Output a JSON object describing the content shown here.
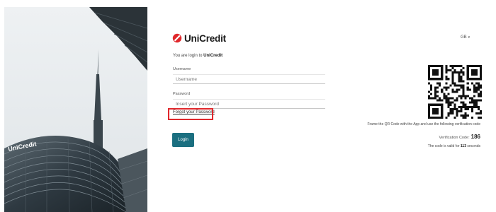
{
  "brand": {
    "name": "UniCredit",
    "building_sign": "UniCredit",
    "accent_color": "#e0282c",
    "primary_color": "#1b6f80"
  },
  "header": {
    "language": "GB",
    "language_icon": "chevron-down-icon"
  },
  "intro": {
    "prefix": "You are login to",
    "brand": "UniCredit"
  },
  "form": {
    "username": {
      "label": "Username",
      "placeholder": "Username",
      "value": ""
    },
    "password": {
      "label": "Password",
      "placeholder": "Insert your Password",
      "value": ""
    },
    "forgot_link": "Forgot your Password",
    "login_button": "Login"
  },
  "qr_panel": {
    "instruction": "Frame the QR Code with the App and use the following verification code",
    "verification_label": "Verification Code:",
    "verification_code": "186",
    "validity_prefix": "The code is valid for",
    "validity_seconds": "113",
    "validity_suffix": "seconds"
  }
}
